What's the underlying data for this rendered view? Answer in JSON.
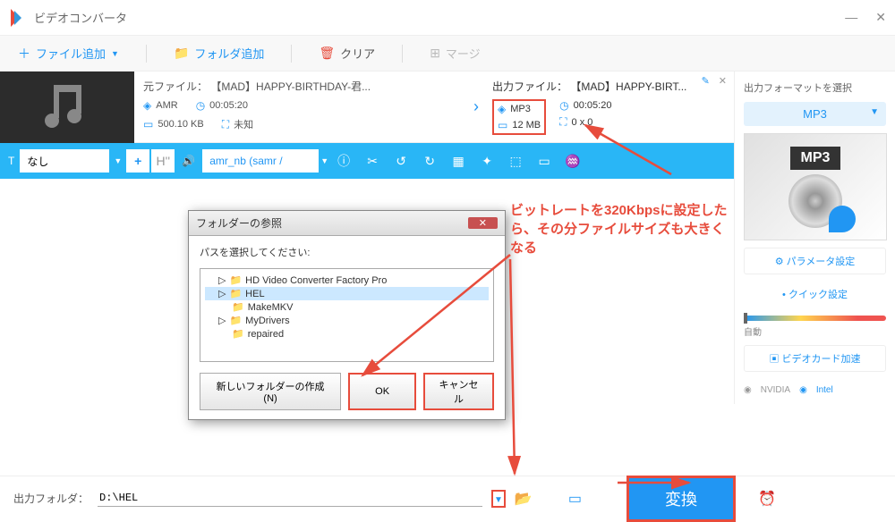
{
  "app": {
    "title": "ビデオコンバータ"
  },
  "toolbar": {
    "add_file": "ファイル追加",
    "add_folder": "フォルダ追加",
    "clear": "クリア",
    "merge": "マージ"
  },
  "source": {
    "label": "元ファイル：",
    "filename": "【MAD】HAPPY-BIRTHDAY-君...",
    "format": "AMR",
    "duration": "00:05:20",
    "size": "500.10 KB",
    "resolution": "未知"
  },
  "output": {
    "label": "出力ファイル：",
    "filename": "【MAD】HAPPY-BIRT...",
    "format": "MP3",
    "duration": "00:05:20",
    "size": "12 MB",
    "resolution": "0 x 0"
  },
  "toolstrip": {
    "text_none": "なし",
    "codec": "amr_nb (samr /"
  },
  "side": {
    "title": "出力フォーマットを選択",
    "format": "MP3",
    "preview_label": "MP3",
    "param_btn": "パラメータ設定",
    "quick_btn": "クイック設定",
    "auto": "自動",
    "gpu_btn": "ビデオカード加速",
    "nvidia": "NVIDIA",
    "intel": "Intel"
  },
  "dialog": {
    "title": "フォルダーの参照",
    "prompt": "パスを選択してください:",
    "items": [
      "HD Video Converter Factory Pro",
      "HEL",
      "MakeMKV",
      "MyDrivers",
      "repaired"
    ],
    "new_folder": "新しいフォルダーの作成(N)",
    "ok": "OK",
    "cancel": "キャンセル"
  },
  "bottom": {
    "label": "出力フォルダ：",
    "path": "D:\\HEL",
    "convert": "変換"
  },
  "annotation": {
    "text": "ビットレートを320Kbpsに設定したら、その分ファイルサイズも大きくなる"
  }
}
